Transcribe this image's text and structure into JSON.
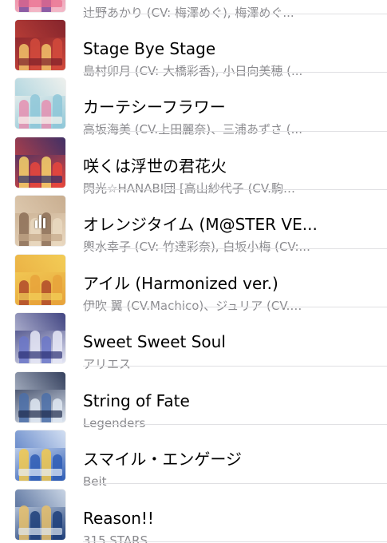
{
  "songs": [
    {
      "title": "",
      "subtitle": "辻野あかり (CV: 梅澤めぐ), 梅澤めぐ..."
    },
    {
      "title": "Stage Bye Stage",
      "subtitle": "島村卯月 (CV: 大橋彩香), 小日向美穂 (..."
    },
    {
      "title": "カーテシーフラワー",
      "subtitle": "高坂海美 (CV.上田麗奈)、三浦あずさ (..."
    },
    {
      "title": "咲くは浮世の君花火",
      "subtitle": "閃光☆HANABI団 [高山紗代子 (CV.駒…"
    },
    {
      "title": "オレンジタイム (M@STER VE...",
      "subtitle": "輿水幸子 (CV: 竹達彩奈), 白坂小梅 (CV:..."
    },
    {
      "title": "アイル (Harmonized ver.)",
      "subtitle": "伊吹 翼 (CV.Machico)、ジュリア (CV.…"
    },
    {
      "title": "Sweet Sweet Soul",
      "subtitle": "アリエス"
    },
    {
      "title": "String of Fate",
      "subtitle": "Legenders"
    },
    {
      "title": "スマイル・エンゲージ",
      "subtitle": "Beit"
    },
    {
      "title": "Reason!!",
      "subtitle": "315 STARS"
    }
  ],
  "now_playing_index": 4,
  "artwork_colors": [
    [
      "#e96a8a",
      "#f2b8c8",
      "#7a4fa0"
    ],
    [
      "#7a1f2a",
      "#d24a3c",
      "#f1c36a"
    ],
    [
      "#fbf6f0",
      "#8ec7d8",
      "#e68fb0"
    ],
    [
      "#2a2d6b",
      "#e6473d",
      "#f6d36b"
    ],
    [
      "#c4a889",
      "#e9d8c0",
      "#8c6e57"
    ],
    [
      "#f4d25a",
      "#e7a33b",
      "#b04a2a"
    ],
    [
      "#2b2f72",
      "#e6e8f6",
      "#6b77c8"
    ],
    [
      "#1e2a4a",
      "#dfe7f2",
      "#4b6ea8"
    ],
    [
      "#e8f0fa",
      "#2f5db5",
      "#f3c94c"
    ],
    [
      "#dfe8f2",
      "#1f3f7a",
      "#e7c06a"
    ]
  ],
  "equalizer_levels": [
    0.55,
    0.9,
    0.7
  ]
}
